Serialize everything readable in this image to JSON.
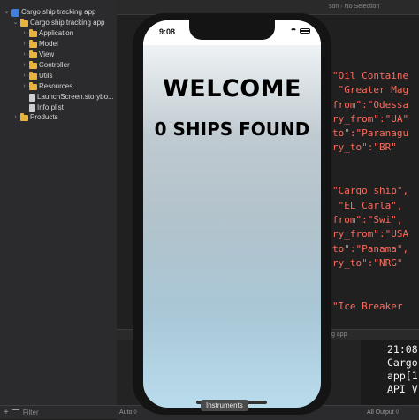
{
  "navigator": {
    "items": [
      {
        "label": "Cargo ship tracking app",
        "icon": "project-icon",
        "chevron": "down",
        "depth": 0
      },
      {
        "label": "Cargo ship tracking app",
        "icon": "folder-icon",
        "chevron": "down",
        "depth": 1
      },
      {
        "label": "Application",
        "icon": "folder-icon",
        "chevron": "right",
        "depth": 2
      },
      {
        "label": "Model",
        "icon": "folder-icon",
        "chevron": "right",
        "depth": 2
      },
      {
        "label": "View",
        "icon": "folder-icon",
        "chevron": "right",
        "depth": 2
      },
      {
        "label": "Controller",
        "icon": "folder-icon",
        "chevron": "right",
        "depth": 2
      },
      {
        "label": "Utils",
        "icon": "folder-icon",
        "chevron": "right",
        "depth": 2
      },
      {
        "label": "Resources",
        "icon": "folder-icon",
        "chevron": "right",
        "depth": 2
      },
      {
        "label": "LaunchScreen.storybo...",
        "icon": "file-icon",
        "chevron": "",
        "depth": 2
      },
      {
        "label": "Info.plist",
        "icon": "file-icon",
        "chevron": "",
        "depth": 2
      },
      {
        "label": "Products",
        "icon": "folder-icon",
        "chevron": "right",
        "depth": 1
      }
    ],
    "filter_placeholder": "Filter"
  },
  "editor": {
    "breadcrumb": [
      "son",
      "No Selection"
    ],
    "code_lines": [
      {
        "text": "\"Oil Containe",
        "color": "#fc6a5d"
      },
      {
        "text": " \"Greater Mag",
        "color": "#fc6a5d"
      },
      {
        "text": "from\":\"Odessa",
        "color": "#fc6a5d"
      },
      {
        "text": "ry_from\":\"UA\"",
        "color": "#fc6a5d"
      },
      {
        "text": "to\":\"Paranagu",
        "color": "#fc6a5d"
      },
      {
        "text": "ry_to\":\"BR\"",
        "color": "#fc6a5d"
      },
      {
        "text": "",
        "color": "#fc6a5d"
      },
      {
        "text": "",
        "color": "#fc6a5d"
      },
      {
        "text": "\"Cargo ship\",",
        "color": "#fc6a5d"
      },
      {
        "text": " \"EL Carla\",",
        "color": "#fc6a5d"
      },
      {
        "text": "from\":\"Swi\",",
        "color": "#fc6a5d"
      },
      {
        "text": "ry_from\":\"USA",
        "color": "#fc6a5d"
      },
      {
        "text": "to\":\"Panama\",",
        "color": "#fc6a5d"
      },
      {
        "text": "ry_to\":\"NRG\"",
        "color": "#fc6a5d"
      },
      {
        "text": "",
        "color": "#fc6a5d"
      },
      {
        "text": "",
        "color": "#fc6a5d"
      },
      {
        "text": "\"Ice Breaker",
        "color": "#fc6a5d"
      }
    ],
    "debug_label": "king app",
    "console_lines": [
      "21:08",
      "Cargo",
      "app[1",
      "API V"
    ],
    "auto_label": "Auto ◊",
    "output_label": "All Output ◊"
  },
  "simulator": {
    "time": "9:08",
    "welcome": "WELCOME",
    "ships_found": "0 SHIPS FOUND"
  },
  "tooltip": {
    "label": "Instruments"
  }
}
